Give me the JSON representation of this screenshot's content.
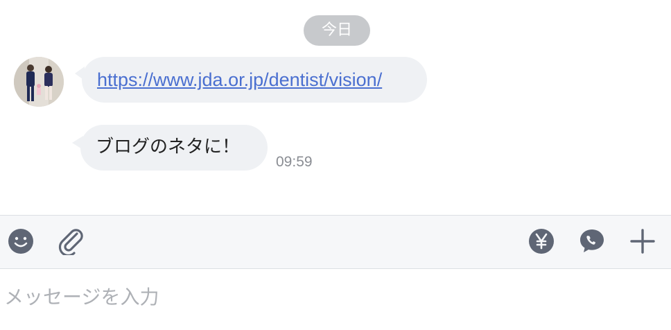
{
  "chat": {
    "date_label": "今日",
    "messages": [
      {
        "type": "link",
        "text": "https://www.jda.or.jp/dentist/vision/"
      },
      {
        "type": "text",
        "text": "ブログのネタに！",
        "time": "09:59"
      }
    ]
  },
  "toolbar": {
    "left_icons": [
      "smiley-icon",
      "paperclip-icon"
    ],
    "right_icons": [
      "yen-icon",
      "chat-phone-icon",
      "plus-icon"
    ],
    "icon_color": "#5f6675"
  },
  "input": {
    "placeholder": "メッセージを入力"
  },
  "colors": {
    "bubble": "#eff1f4",
    "link": "#4a6fd0",
    "date_chip": "#c7c9cc",
    "toolbar_bg": "#f6f7f9"
  }
}
